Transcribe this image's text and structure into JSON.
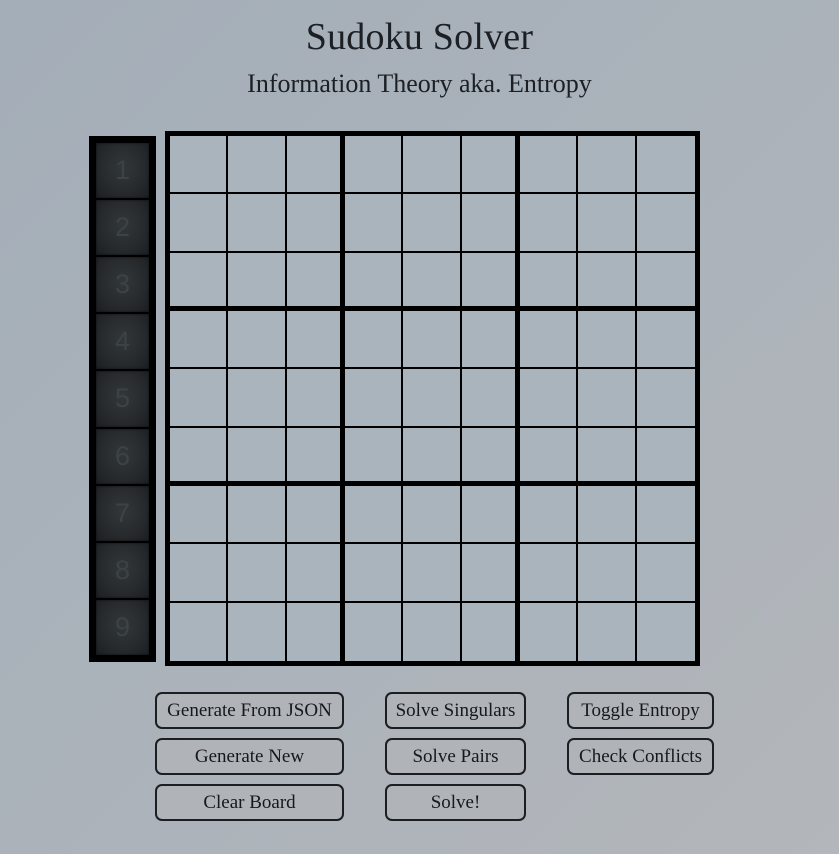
{
  "header": {
    "title": "Sudoku Solver",
    "subtitle": "Information Theory aka. Entropy"
  },
  "colors": {
    "page_background_top_left": "#a4aeb8",
    "page_background_bottom_right": "#b3b6ba",
    "grid_cell": "#aab4bd",
    "grid_line": "#000000",
    "sidebar_cell": "#272b2e",
    "sidebar_number_text": "#3d4245",
    "button_face": "#b0b3b7",
    "button_border": "#1c1f22",
    "text": "#1c2025"
  },
  "number_sidebar": {
    "name": "digit-palette",
    "cells": [
      {
        "label": "1"
      },
      {
        "label": "2"
      },
      {
        "label": "3"
      },
      {
        "label": "4"
      },
      {
        "label": "5"
      },
      {
        "label": "6"
      },
      {
        "label": "7"
      },
      {
        "label": "8"
      },
      {
        "label": "9"
      }
    ]
  },
  "board": {
    "size": 9,
    "box_size": 3,
    "cells": [
      [
        "",
        "",
        "",
        "",
        "",
        "",
        "",
        "",
        ""
      ],
      [
        "",
        "",
        "",
        "",
        "",
        "",
        "",
        "",
        ""
      ],
      [
        "",
        "",
        "",
        "",
        "",
        "",
        "",
        "",
        ""
      ],
      [
        "",
        "",
        "",
        "",
        "",
        "",
        "",
        "",
        ""
      ],
      [
        "",
        "",
        "",
        "",
        "",
        "",
        "",
        "",
        ""
      ],
      [
        "",
        "",
        "",
        "",
        "",
        "",
        "",
        "",
        ""
      ],
      [
        "",
        "",
        "",
        "",
        "",
        "",
        "",
        "",
        ""
      ],
      [
        "",
        "",
        "",
        "",
        "",
        "",
        "",
        "",
        ""
      ],
      [
        "",
        "",
        "",
        "",
        "",
        "",
        "",
        "",
        ""
      ]
    ]
  },
  "buttons": {
    "rows": [
      [
        {
          "label": "Generate From JSON",
          "name": "generate-from-json-button",
          "col": "col-a"
        },
        {
          "label": "Solve Singulars",
          "name": "solve-singulars-button",
          "col": "col-b"
        },
        {
          "label": "Toggle Entropy",
          "name": "toggle-entropy-button",
          "col": "col-c"
        }
      ],
      [
        {
          "label": "Generate New",
          "name": "generate-new-button",
          "col": "col-a"
        },
        {
          "label": "Solve Pairs",
          "name": "solve-pairs-button",
          "col": "col-b"
        },
        {
          "label": "Check Conflicts",
          "name": "check-conflicts-button",
          "col": "col-c"
        }
      ],
      [
        {
          "label": "Clear Board",
          "name": "clear-board-button",
          "col": "col-a"
        },
        {
          "label": "Solve!",
          "name": "solve-button",
          "col": "col-b"
        }
      ]
    ]
  }
}
